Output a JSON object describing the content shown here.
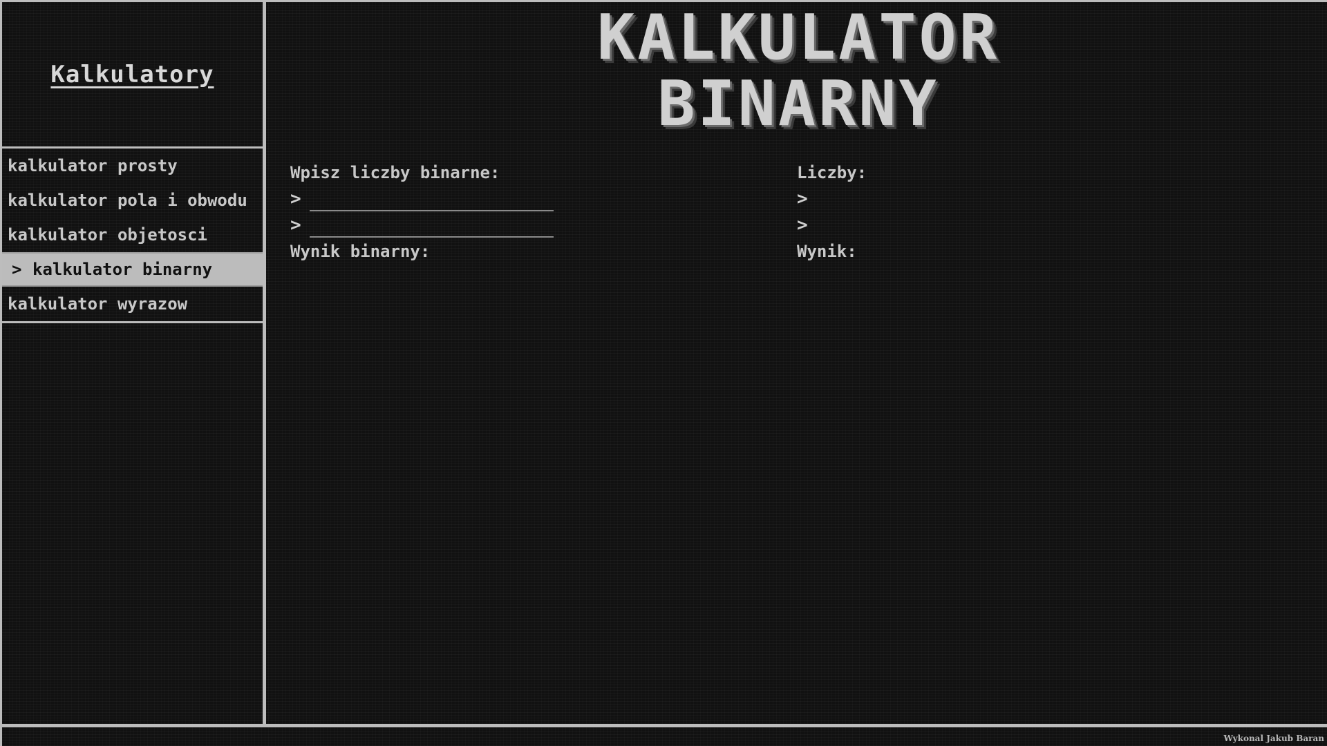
{
  "sidebar": {
    "title": "Kalkulatory",
    "items": [
      {
        "label": "kalkulator prosty",
        "active": false
      },
      {
        "label": "kalkulator pola i obwodu",
        "active": false
      },
      {
        "label": "kalkulator objetosci",
        "active": false
      },
      {
        "label": "kalkulator binarny",
        "active": true,
        "marker": ">"
      },
      {
        "label": "kalkulator wyrazow",
        "active": false
      }
    ]
  },
  "header": {
    "line1": "KALKULATOR",
    "line2": "BINARNY"
  },
  "binary_panel": {
    "label": "Wpisz liczby binarne:",
    "prompt": ">",
    "input1_value": "",
    "input2_value": "",
    "result_label": "Wynik binarny:",
    "result_value": ""
  },
  "decimal_panel": {
    "label": "Liczby:",
    "prompt": ">",
    "value1": "",
    "value2": "",
    "result_label": "Wynik:",
    "result_value": ""
  },
  "footer": {
    "credit": "Wykonal Jakub Baran"
  },
  "colors": {
    "background": "#111111",
    "foreground": "#c8c8c8",
    "border": "#bdbdbd",
    "active_bg": "#bcbcbc"
  }
}
